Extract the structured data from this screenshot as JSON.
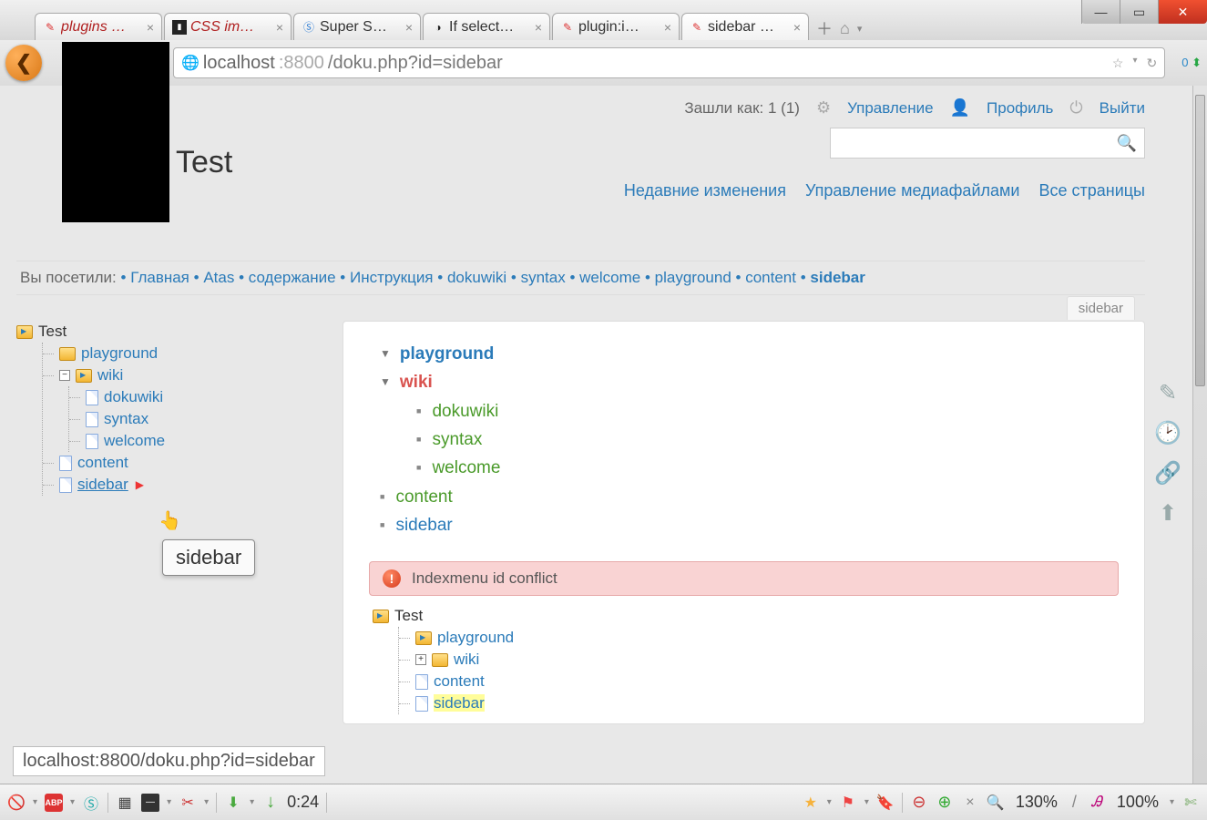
{
  "tabs": [
    {
      "title": "plugins …",
      "icon": "doku"
    },
    {
      "title": "CSS im…",
      "icon": "dark"
    },
    {
      "title": "Super S…",
      "icon": "s"
    },
    {
      "title": "If select…",
      "icon": "gh"
    },
    {
      "title": "plugin:i…",
      "icon": "doku"
    },
    {
      "title": "sidebar …",
      "icon": "doku",
      "active": true
    }
  ],
  "url": {
    "host": "localhost",
    "port": ":8800",
    "path": "/doku.php?id=sidebar"
  },
  "site_title": "Test",
  "user_row": {
    "logged_as": "Зашли как: 1 (1)",
    "admin": "Управление",
    "profile": "Профиль",
    "logout": "Выйти"
  },
  "top_links": {
    "recent": "Недавние изменения",
    "media": "Управление медиафайлами",
    "all": "Все страницы"
  },
  "breadcrumbs": {
    "label": "Вы посетили:",
    "items": [
      "Главная",
      "Atas",
      "содержание",
      "Инструкция",
      "dokuwiki",
      "syntax",
      "welcome",
      "playground",
      "content",
      "sidebar"
    ]
  },
  "leftTree": {
    "root": "Test",
    "playground": "playground",
    "wiki": "wiki",
    "wiki_children": [
      "dokuwiki",
      "syntax",
      "welcome"
    ],
    "content": "content",
    "sidebar": "sidebar"
  },
  "tooltip": "sidebar",
  "content_tab": "sidebar",
  "idx": {
    "playground": "playground",
    "wiki": "wiki",
    "wiki_children": [
      "dokuwiki",
      "syntax",
      "welcome"
    ],
    "content": "content",
    "sidebar": "sidebar"
  },
  "error_msg": "Indexmenu id conflict",
  "bottomTree": {
    "root": "Test",
    "playground": "playground",
    "wiki": "wiki",
    "content": "content",
    "sidebar": "sidebar"
  },
  "status_url": "localhost:8800/doku.php?id=sidebar",
  "bottom": {
    "time": "0:24",
    "zoom1": "130%",
    "zoom2": "100%"
  }
}
